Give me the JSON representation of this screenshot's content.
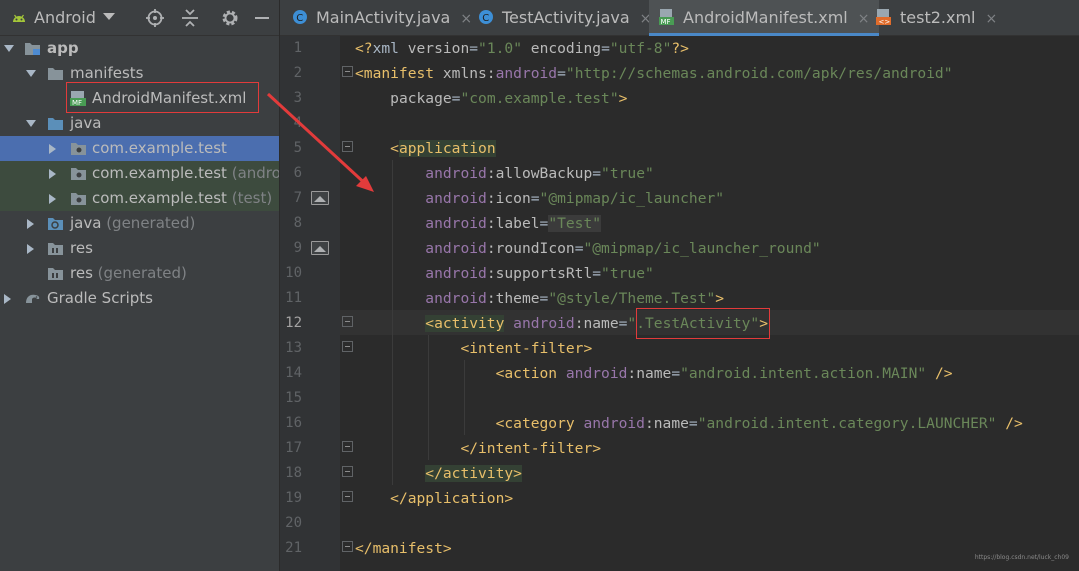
{
  "project_panel": {
    "title": "Android",
    "tree": [
      {
        "label": "app",
        "suffix": ""
      },
      {
        "label": "manifests",
        "suffix": ""
      },
      {
        "label": "AndroidManifest.xml",
        "suffix": ""
      },
      {
        "label": "java",
        "suffix": ""
      },
      {
        "label": "com.example.test",
        "suffix": ""
      },
      {
        "label": "com.example.test",
        "suffix": " (androi"
      },
      {
        "label": "com.example.test",
        "suffix": " (test)"
      },
      {
        "label": "java",
        "suffix": " (generated)"
      },
      {
        "label": "res",
        "suffix": ""
      },
      {
        "label": "res",
        "suffix": " (generated)"
      },
      {
        "label": "Gradle Scripts",
        "suffix": ""
      }
    ]
  },
  "tabs": [
    {
      "label": "MainActivity.java",
      "close": "×"
    },
    {
      "label": "TestActivity.java",
      "close": "×"
    },
    {
      "label": "AndroidManifest.xml",
      "close": "×",
      "active": true
    },
    {
      "label": "test2.xml",
      "close": "×"
    }
  ],
  "editor": {
    "current_line": 12,
    "line_numbers": [
      "1",
      "2",
      "3",
      "4",
      "5",
      "6",
      "7",
      "8",
      "9",
      "10",
      "11",
      "12",
      "13",
      "14",
      "15",
      "16",
      "17",
      "18",
      "19",
      "20",
      "21"
    ],
    "lines": [
      [
        [
          "t",
          "<?"
        ],
        [
          "p",
          "xml "
        ],
        [
          "a",
          "version"
        ],
        [
          "p",
          "="
        ],
        [
          "v",
          "\"1.0\""
        ],
        [
          "p",
          " "
        ],
        [
          "a",
          "encoding"
        ],
        [
          "p",
          "="
        ],
        [
          "v",
          "\"utf-8\""
        ],
        [
          "t",
          "?>"
        ]
      ],
      [
        [
          "t",
          "<manifest "
        ],
        [
          "a",
          "xmlns:"
        ],
        [
          "ns",
          "android"
        ],
        [
          "p",
          "="
        ],
        [
          "v",
          "\"http://schemas.android.com/apk/res/android\""
        ]
      ],
      [
        [
          "p",
          "    "
        ],
        [
          "a",
          "package"
        ],
        [
          "p",
          "="
        ],
        [
          "v",
          "\"com.example.test\""
        ],
        [
          "t",
          ">"
        ]
      ],
      [],
      [
        [
          "p",
          "    "
        ],
        [
          "t",
          "<"
        ],
        [
          "thl",
          "application"
        ]
      ],
      [
        [
          "p",
          "        "
        ],
        [
          "ns",
          "android"
        ],
        [
          "a",
          ":allowBackup"
        ],
        [
          "p",
          "="
        ],
        [
          "v",
          "\"true\""
        ]
      ],
      [
        [
          "p",
          "        "
        ],
        [
          "ns",
          "android"
        ],
        [
          "a",
          ":icon"
        ],
        [
          "p",
          "="
        ],
        [
          "v",
          "\"@mipmap/ic_launcher\""
        ]
      ],
      [
        [
          "p",
          "        "
        ],
        [
          "ns",
          "android"
        ],
        [
          "a",
          ":label"
        ],
        [
          "p",
          "="
        ],
        [
          "vhl",
          "\"Test\""
        ]
      ],
      [
        [
          "p",
          "        "
        ],
        [
          "ns",
          "android"
        ],
        [
          "a",
          ":roundIcon"
        ],
        [
          "p",
          "="
        ],
        [
          "v",
          "\"@mipmap/ic_launcher_round\""
        ]
      ],
      [
        [
          "p",
          "        "
        ],
        [
          "ns",
          "android"
        ],
        [
          "a",
          ":supportsRtl"
        ],
        [
          "p",
          "="
        ],
        [
          "v",
          "\"true\""
        ]
      ],
      [
        [
          "p",
          "        "
        ],
        [
          "ns",
          "android"
        ],
        [
          "a",
          ":theme"
        ],
        [
          "p",
          "="
        ],
        [
          "v",
          "\"@style/Theme.Test\""
        ],
        [
          "t",
          ">"
        ]
      ],
      [
        [
          "p",
          "        "
        ],
        [
          "thl",
          "<activity"
        ],
        [
          "p",
          " "
        ],
        [
          "ns",
          "android"
        ],
        [
          "a",
          ":name"
        ],
        [
          "p",
          "="
        ],
        [
          "v",
          "\".TestActivity\""
        ],
        [
          "t",
          ">"
        ]
      ],
      [
        [
          "p",
          "            "
        ],
        [
          "t",
          "<intent-filter>"
        ]
      ],
      [
        [
          "p",
          "                "
        ],
        [
          "t",
          "<action "
        ],
        [
          "ns",
          "android"
        ],
        [
          "a",
          ":name"
        ],
        [
          "p",
          "="
        ],
        [
          "v",
          "\"android.intent.action.MAIN\""
        ],
        [
          "t",
          " />"
        ]
      ],
      [],
      [
        [
          "p",
          "                "
        ],
        [
          "t",
          "<category "
        ],
        [
          "ns",
          "android"
        ],
        [
          "a",
          ":name"
        ],
        [
          "p",
          "="
        ],
        [
          "v",
          "\"android.intent.category.LAUNCHER\""
        ],
        [
          "t",
          " />"
        ]
      ],
      [
        [
          "p",
          "            "
        ],
        [
          "t",
          "</intent-filter>"
        ]
      ],
      [
        [
          "p",
          "        "
        ],
        [
          "thl",
          "</activity>"
        ]
      ],
      [
        [
          "p",
          "    "
        ],
        [
          "t",
          "</application>"
        ]
      ],
      [],
      [
        [
          "t",
          "</manifest>"
        ]
      ]
    ]
  },
  "watermark": "https://blog.csdn.net/luck_ch09",
  "colors": {
    "tag": "#e8bf6a",
    "attribute": "#bababa",
    "namespace": "#9876aa",
    "value": "#6a8759",
    "selection": "#4b6eaf",
    "annotation_red": "#e23b3b"
  }
}
